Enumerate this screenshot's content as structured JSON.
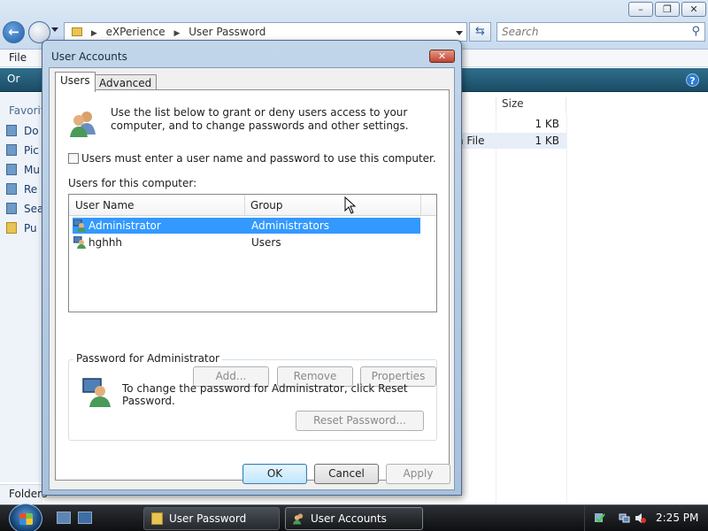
{
  "explorer": {
    "breadcrumb": [
      "eXPerience",
      "User Password"
    ],
    "search_placeholder": "Search",
    "menu_file": "File",
    "command_organize": "Or",
    "nav_favorites": "Favorit",
    "nav_items": [
      "Do",
      "Pic",
      "Mu",
      "Re",
      "Sea",
      "Pu"
    ],
    "folders_label": "Folders",
    "column_size": "Size",
    "files": [
      {
        "name": "t",
        "size": "1 KB"
      },
      {
        "name": "n File",
        "size": "1 KB"
      }
    ],
    "caption_buttons": [
      "–",
      "❐",
      "✕"
    ]
  },
  "dialog": {
    "title": "User Accounts",
    "close_glyph": "✕",
    "tabs": [
      "Users",
      "Advanced"
    ],
    "intro_text": "Use the list below to grant or deny users access to your computer, and to change passwords and other settings.",
    "require_password_checkbox": "Users must enter a user name and password to use this computer.",
    "users_label": "Users for this computer:",
    "columns": [
      "User Name",
      "Group"
    ],
    "users": [
      {
        "name": "Administrator",
        "group": "Administrators",
        "selected": true
      },
      {
        "name": "hghhh",
        "group": "Users",
        "selected": false
      }
    ],
    "buttons": {
      "add": "Add...",
      "remove": "Remove",
      "properties": "Properties"
    },
    "password_group_title": "Password for Administrator",
    "password_text": "To change the password for Administrator, click Reset Password.",
    "reset_password": "Reset Password...",
    "ok": "OK",
    "cancel": "Cancel",
    "apply": "Apply"
  },
  "taskbar": {
    "tasks": [
      "User Password",
      "User Accounts"
    ],
    "clock": "2:25 PM"
  },
  "colors": {
    "selection": "#3399ff",
    "taskbar": "#1a1c1f",
    "dialog_frame": "#b4cbe3"
  }
}
